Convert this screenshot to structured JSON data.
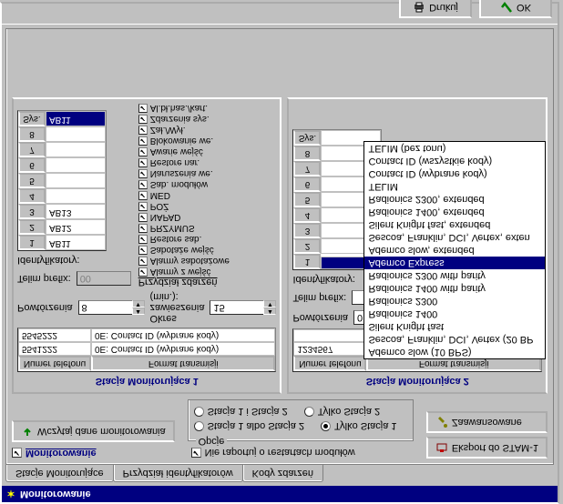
{
  "window": {
    "title": "Monitorowanie"
  },
  "tabs": [
    "Stacje Monitorujące",
    "Przydział identyfikatorów",
    "Kody zdarzeń"
  ],
  "top": {
    "monitoring_label": "Monitorowanie",
    "read_button": "Wczytaj dane monitorowania",
    "export_button": "Eksport do STAM-1",
    "advanced_button": "Zaawansowane",
    "noreport_label": "Nie raportuj o restartach modułów",
    "options_title": "Opcje",
    "opt1": "Stacja 1 albo Stacja 2",
    "opt2": "Stacja 1 i Stacja 2",
    "opt3": "Tylko Stacja 1",
    "opt4": "Tylko Stacja 2"
  },
  "station_labels": {
    "s1": "Stacja Monitorująca 1",
    "s2": "Stacja Monitorująca 2",
    "phone": "Numer telefonu",
    "format": "Format transmisji",
    "reps": "Powtórzenia",
    "suspend": "Okres zawieszenia (min.):",
    "telim": "Telim prefix:",
    "ident": "Identyfikatory:",
    "events_hdr": "Przydział zdarzeń"
  },
  "station1": {
    "phones": [
      {
        "num": "5541222",
        "fmt": "0E: Contact ID (wybrane kody)"
      },
      {
        "num": "5545222",
        "fmt": "0E: Contact ID (wybrane kody)"
      }
    ],
    "reps": "8",
    "suspend": "15",
    "telim": "00",
    "ident_rows": [
      {
        "n": "1",
        "v": "AB11"
      },
      {
        "n": "2",
        "v": "AB12"
      },
      {
        "n": "3",
        "v": "AB13"
      },
      {
        "n": "4",
        "v": ""
      },
      {
        "n": "5",
        "v": ""
      },
      {
        "n": "6",
        "v": ""
      },
      {
        "n": "7",
        "v": ""
      },
      {
        "n": "8",
        "v": ""
      },
      {
        "n": "Sys.",
        "v": "AB11"
      }
    ],
    "events": [
      "Alarmy z wejść",
      "Alarmy sabotażowe",
      "Sabotaże wejść",
      "Restore sab.",
      "PRZYMUS",
      "NAPAD",
      "POŻ",
      "MED",
      "Sab. modułów",
      "Naruszenia we.",
      "Restore nar.",
      "Awarie wejść",
      "Blokowanie we.",
      "Zał./Wył.",
      "Zdarzenia sys.",
      "Al.bł.has./kart."
    ]
  },
  "station2": {
    "phones": [
      {
        "num": "1234567",
        "fmt": ""
      }
    ],
    "reps": "0",
    "telim": "",
    "ident_rows": [
      {
        "n": "1",
        "v": ""
      },
      {
        "n": "2",
        "v": ""
      },
      {
        "n": "3",
        "v": ""
      },
      {
        "n": "4",
        "v": ""
      },
      {
        "n": "5",
        "v": ""
      },
      {
        "n": "6",
        "v": ""
      },
      {
        "n": "7",
        "v": ""
      },
      {
        "n": "8",
        "v": ""
      },
      {
        "n": "Sys.",
        "v": ""
      }
    ],
    "events": [
      "Naruszenia we.",
      "Restore nar.",
      "Awarie wejść",
      "Blokowanie we.",
      "Zał./Wył.",
      "Zdarzenia sys.",
      "Al.bł.has./kart."
    ]
  },
  "dropdown": {
    "options": [
      "Ademco slow (10 BPS)",
      "Sescoa, Franklin, DCI, Vertex (20 BP",
      "Silent Knight fast",
      "Radionics 1400",
      "Radionics 2300",
      "Radionics 1400 with parity",
      "Radionics 2300 with parity",
      "Ademco Express",
      "Ademco slow, extended",
      "Sescoa, Franklin, DCI, Vertex, exten",
      "Silent Knight fast, extended",
      "Radionics 1400, extended",
      "Radionics 2300, extended",
      "TELIM",
      "Contact ID (wybrane kody)",
      "Contact ID (wszystkie kody)",
      "TELIM (bez tonu)"
    ],
    "selected": "Ademco Express"
  },
  "footer": {
    "print": "Drukuj",
    "ok": "OK"
  }
}
